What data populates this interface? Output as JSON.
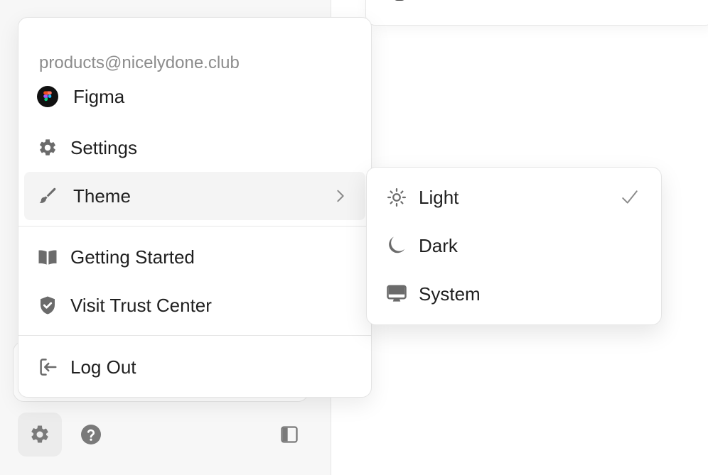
{
  "account": {
    "email": "products@nicelydone.club"
  },
  "menu": {
    "items": [
      {
        "label": "Figma",
        "icon": "figma-logo"
      },
      {
        "label": "Settings",
        "icon": "gear-icon"
      },
      {
        "label": "Theme",
        "icon": "paintbrush-icon",
        "has_submenu": true
      },
      {
        "label": "Getting Started",
        "icon": "book-icon"
      },
      {
        "label": "Visit Trust Center",
        "icon": "shield-check-icon"
      },
      {
        "label": "Log Out",
        "icon": "logout-icon"
      }
    ]
  },
  "theme_submenu": {
    "options": [
      {
        "label": "Light",
        "icon": "sun-icon",
        "selected": true
      },
      {
        "label": "Dark",
        "icon": "moon-icon",
        "selected": false
      },
      {
        "label": "System",
        "icon": "monitor-icon",
        "selected": false
      }
    ]
  },
  "bottom_bar": {
    "buttons": [
      {
        "icon": "gear-icon",
        "active": true
      },
      {
        "icon": "help-icon",
        "active": false
      },
      {
        "icon": "sidebar-toggle-icon",
        "active": false
      }
    ]
  },
  "colors": {
    "icon": "#6b6b6b",
    "text": "#1f1f1f",
    "muted": "#8c8c8c",
    "hover_bg": "#f4f4f4",
    "sidebar_bg": "#f7f7f7"
  }
}
